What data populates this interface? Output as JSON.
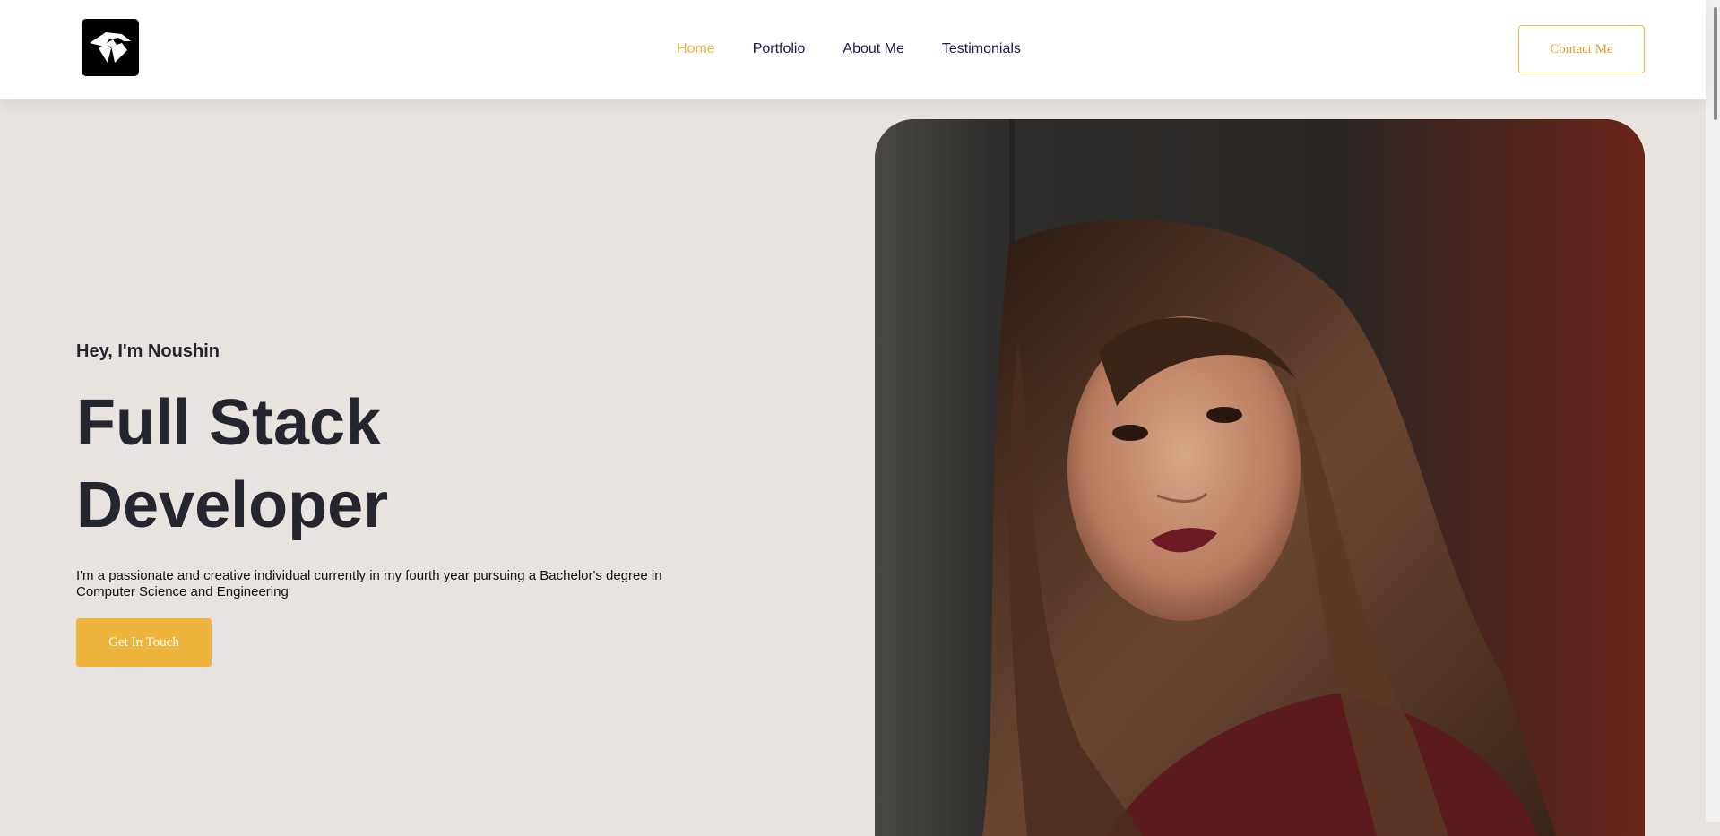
{
  "header": {
    "logo_icon": "geometric-bird-logo-icon",
    "nav": [
      {
        "label": "Home",
        "active": true
      },
      {
        "label": "Portfolio",
        "active": false
      },
      {
        "label": "About Me",
        "active": false
      },
      {
        "label": "Testimonials",
        "active": false
      }
    ],
    "contact_label": "Contact Me"
  },
  "hero": {
    "greeting": "Hey, I'm Noushin",
    "headline_line1": "Full Stack",
    "headline_line2": "Developer",
    "description": "I'm a passionate and creative individual currently in my fourth year pursuing a Bachelor's degree in Computer Science and Engineering",
    "cta_label": "Get In Touch",
    "portrait_image": "woman-portrait-photo"
  },
  "colors": {
    "accent": "#efb43d",
    "nav_text": "#1c1b4d",
    "heading": "#24252f",
    "page_bg": "#e9e3df"
  }
}
